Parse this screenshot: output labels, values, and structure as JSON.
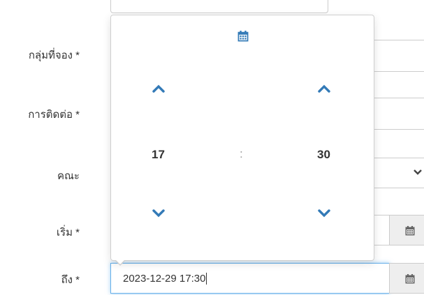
{
  "form": {
    "labels": {
      "group": "กลุ่มที่จอง *",
      "contact": "การติดต่อ *",
      "faculty": "คณะ",
      "start": "เริ่ม *",
      "end": "ถึง *"
    },
    "end_value": "2023-12-29 17:30"
  },
  "picker": {
    "hour": "17",
    "separator": ":",
    "minute": "30"
  },
  "colors": {
    "accent": "#337ab7",
    "icon": "#555555",
    "focus_border": "#66afe9"
  },
  "icons": {
    "calendar": "calendar-icon",
    "up": "chevron-up-icon",
    "down": "chevron-down-icon"
  }
}
